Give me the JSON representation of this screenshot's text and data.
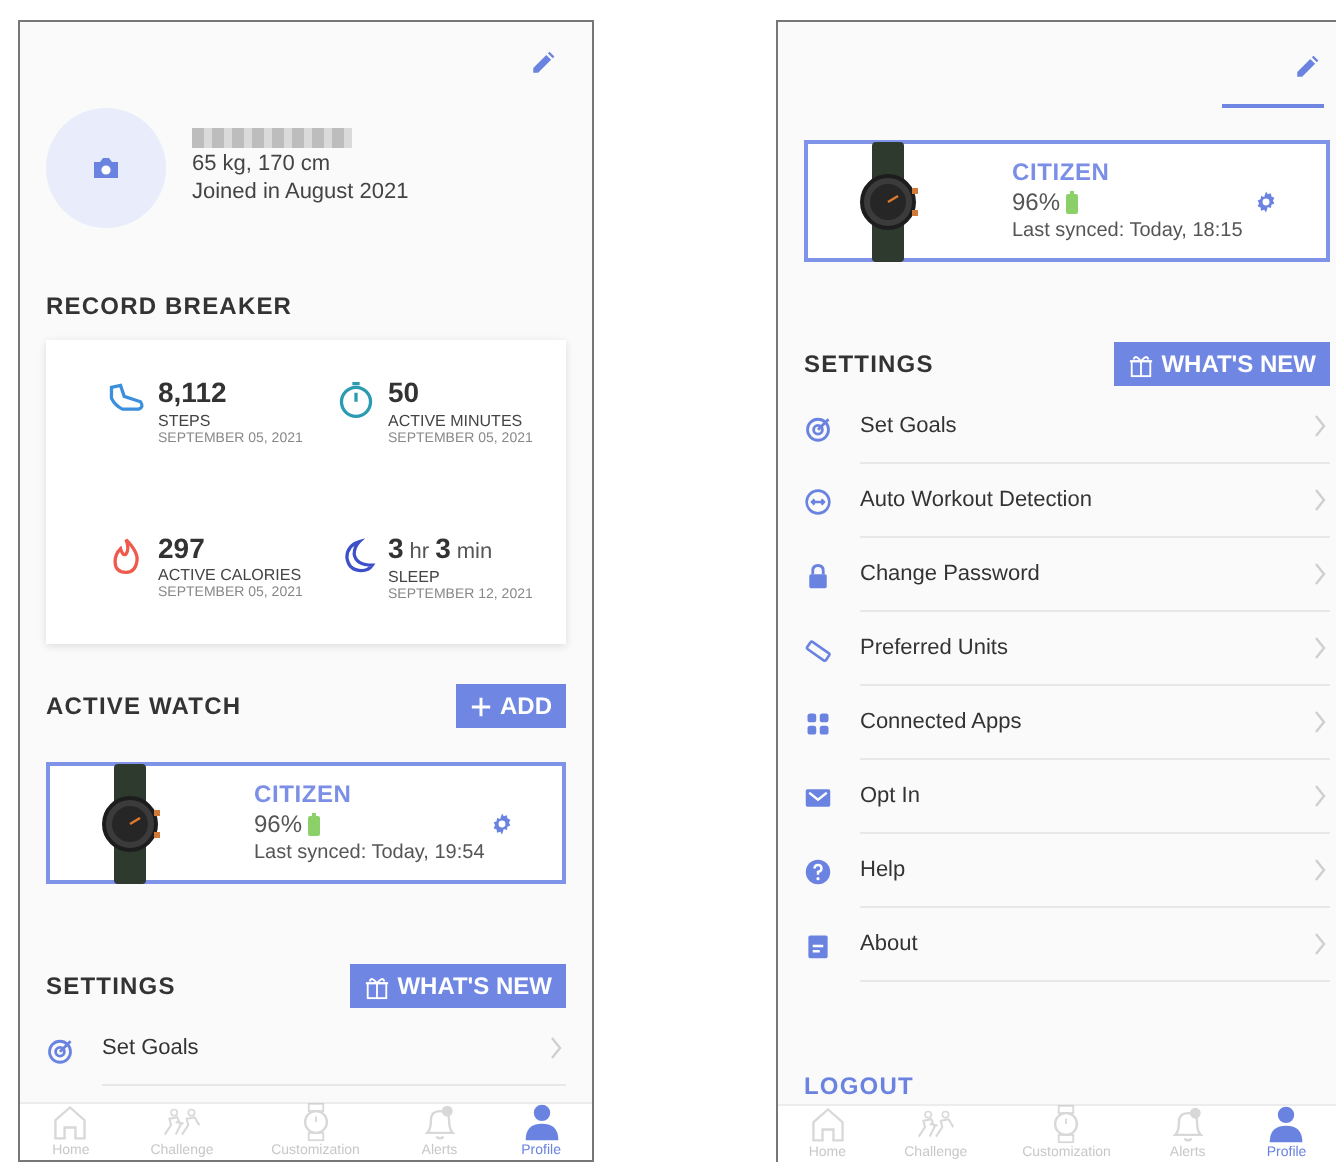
{
  "screens": [
    {
      "profile": {
        "stats": "65 kg, 170 cm",
        "joined": "Joined in August 2021"
      },
      "record_breaker": {
        "title": "RECORD BREAKER",
        "records": [
          {
            "kind": "steps",
            "value": "8,112",
            "label": "STEPS",
            "date": "SEPTEMBER 05, 2021"
          },
          {
            "kind": "minutes",
            "value": "50",
            "label": "ACTIVE MINUTES",
            "date": "SEPTEMBER 05, 2021"
          },
          {
            "kind": "calories",
            "value": "297",
            "label": "ACTIVE CALORIES",
            "date": "SEPTEMBER 05, 2021"
          },
          {
            "kind": "sleep",
            "value": "3",
            "unit": "hr",
            "value2": "3",
            "unit2": "min",
            "label": "SLEEP",
            "date": "SEPTEMBER 12, 2021"
          }
        ]
      },
      "active_watch": {
        "title": "ACTIVE WATCH",
        "add_label": "ADD",
        "brand": "CITIZEN",
        "battery": "96%",
        "last_synced": "Last synced: Today, 19:54"
      },
      "settings": {
        "title": "SETTINGS",
        "whats_new": "WHAT'S NEW",
        "items": [
          {
            "kind": "goals",
            "label": "Set Goals"
          }
        ]
      },
      "nav": [
        {
          "kind": "home",
          "label": "Home",
          "selected": false
        },
        {
          "kind": "challenge",
          "label": "Challenge",
          "selected": false
        },
        {
          "kind": "watch",
          "label": "Customization",
          "selected": false
        },
        {
          "kind": "alerts",
          "label": "Alerts",
          "selected": false
        },
        {
          "kind": "profile",
          "label": "Profile",
          "selected": true
        }
      ]
    },
    {
      "active_watch": {
        "brand": "CITIZEN",
        "battery": "96%",
        "last_synced": "Last synced: Today, 18:15"
      },
      "settings": {
        "title": "SETTINGS",
        "whats_new": "WHAT'S NEW",
        "items": [
          {
            "kind": "goals",
            "label": "Set Goals"
          },
          {
            "kind": "workout",
            "label": "Auto Workout Detection"
          },
          {
            "kind": "password",
            "label": "Change Password"
          },
          {
            "kind": "units",
            "label": "Preferred Units"
          },
          {
            "kind": "apps",
            "label": "Connected Apps"
          },
          {
            "kind": "optin",
            "label": "Opt In"
          },
          {
            "kind": "help",
            "label": "Help"
          },
          {
            "kind": "about",
            "label": "About"
          }
        ]
      },
      "logout": "LOGOUT",
      "nav": [
        {
          "kind": "home",
          "label": "Home",
          "selected": false
        },
        {
          "kind": "challenge",
          "label": "Challenge",
          "selected": false
        },
        {
          "kind": "watch",
          "label": "Customization",
          "selected": false
        },
        {
          "kind": "alerts",
          "label": "Alerts",
          "selected": false
        },
        {
          "kind": "profile",
          "label": "Profile",
          "selected": true
        }
      ]
    }
  ]
}
